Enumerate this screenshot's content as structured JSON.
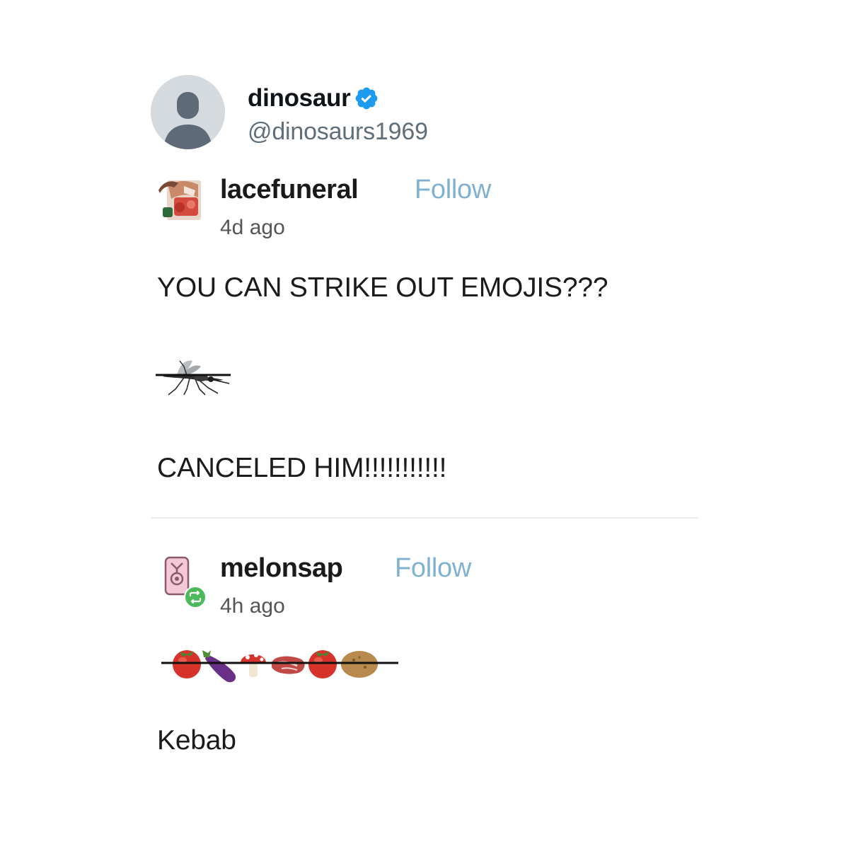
{
  "account": {
    "name": "dinosaur",
    "handle": "@dinosaurs1969",
    "verified": true,
    "avatar_icon": "default-user-avatar-icon",
    "badge_color": "#1d9bf0"
  },
  "posts": [
    {
      "username": "lacefuneral",
      "follow_label": "Follow",
      "time": "4d ago",
      "lines": [
        "YOU CAN STRIKE OUT EMOJIS???",
        "CANCELED HIM!!!!!!!!!!!"
      ],
      "emoji": [
        "mosquito"
      ],
      "emoji_struck_out": true
    },
    {
      "username": "melonsap",
      "follow_label": "Follow",
      "time": "4h ago",
      "lines": [
        "Kebab"
      ],
      "emoji": [
        "tomato",
        "eggplant",
        "mushroom",
        "cut-of-meat",
        "tomato",
        "potato"
      ],
      "emoji_struck_out": true,
      "reblog_badge": "reblog-icon"
    }
  ],
  "colors": {
    "follow": "#7fb1d1",
    "handle": "#5f6e7b",
    "reblog_badge": "#4cba5a"
  }
}
